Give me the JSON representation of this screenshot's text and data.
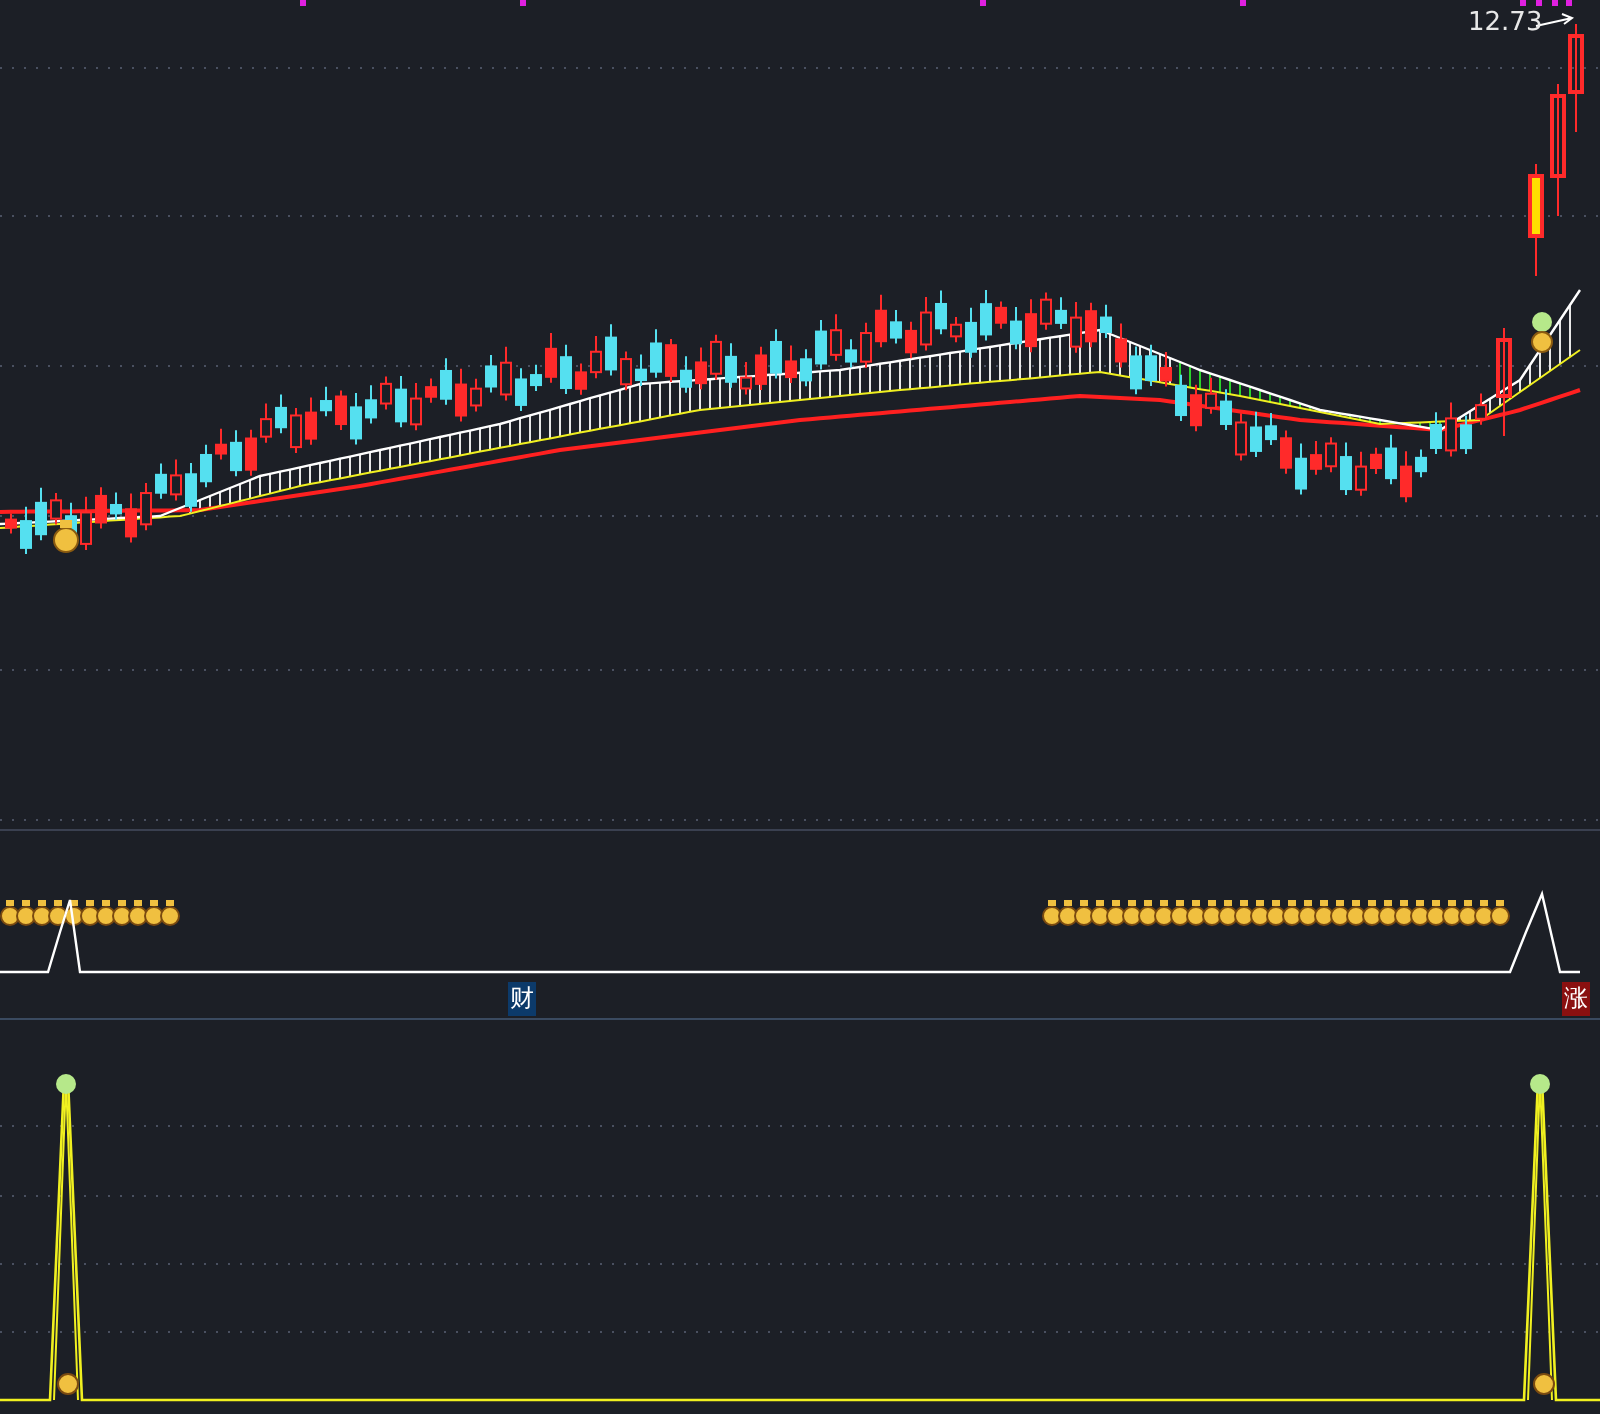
{
  "price_chart": {
    "price_label": "12.73"
  },
  "indicator_panel": {
    "label": "财"
  },
  "signal_panel": {
    "label": "涨"
  }
}
